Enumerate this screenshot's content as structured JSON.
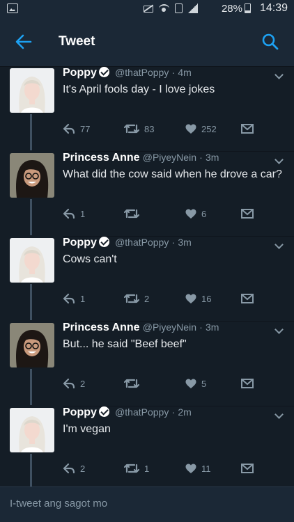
{
  "status_bar": {
    "battery": "28%",
    "time": "14:39",
    "icons": [
      "gallery-icon",
      "mute-icon",
      "wifi-icon",
      "sim-icon",
      "signal-icon",
      "battery-icon"
    ]
  },
  "header": {
    "title": "Tweet",
    "back_icon": "back-arrow-icon",
    "search_icon": "search-icon"
  },
  "colors": {
    "background": "#141d26",
    "bar": "#1b2836",
    "accent": "#1da1f2",
    "muted": "#8899a6",
    "text": "#e6e9ec"
  },
  "tweets": [
    {
      "name": "Poppy",
      "verified": true,
      "handle": "@thatPoppy",
      "dot": "·",
      "time": "4m",
      "text": "It's April fools day - I love jokes",
      "replies": "77",
      "retweets": "83",
      "likes": "252"
    },
    {
      "name": "Princess Anne",
      "verified": false,
      "handle": "@PiyeyNein",
      "dot": "·",
      "time": "3m",
      "text": "What did the cow said when he drove a car?",
      "replies": "1",
      "retweets": "",
      "likes": "6"
    },
    {
      "name": "Poppy",
      "verified": true,
      "handle": "@thatPoppy",
      "dot": "·",
      "time": "3m",
      "text": "Cows can't",
      "replies": "1",
      "retweets": "2",
      "likes": "16"
    },
    {
      "name": "Princess Anne",
      "verified": false,
      "handle": "@PiyeyNein",
      "dot": "·",
      "time": "3m",
      "text": "But... he said \"Beef beef\"",
      "replies": "2",
      "retweets": "",
      "likes": "5"
    },
    {
      "name": "Poppy",
      "verified": true,
      "handle": "@thatPoppy",
      "dot": "·",
      "time": "2m",
      "text": "I'm vegan",
      "replies": "2",
      "retweets": "1",
      "likes": "11"
    }
  ],
  "reply_bar": {
    "placeholder": "I-tweet ang sagot mo"
  }
}
